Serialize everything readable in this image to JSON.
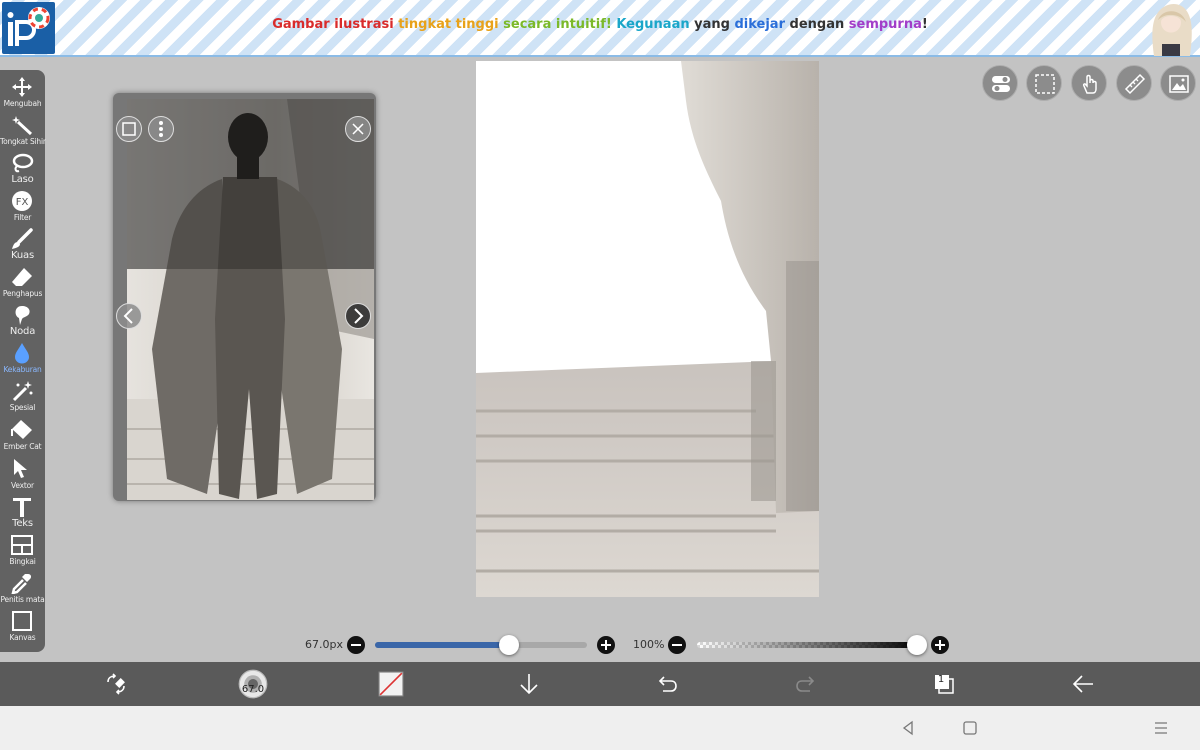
{
  "banner": {
    "segments": [
      {
        "text": "Gambar ilustrasi ",
        "color": "#d92b2b"
      },
      {
        "text": "tingkat tinggi ",
        "color": "#e8a21a"
      },
      {
        "text": "secara intuitif! ",
        "color": "#7bb929"
      },
      {
        "text": "Kegunaan ",
        "color": "#1aa6c9"
      },
      {
        "text": "yang ",
        "color": "#333333"
      },
      {
        "text": "dikejar ",
        "color": "#2b6fd9"
      },
      {
        "text": "dengan ",
        "color": "#333333"
      },
      {
        "text": "sempurna",
        "color": "#a23ec9"
      },
      {
        "text": "!",
        "color": "#333333"
      }
    ]
  },
  "toolbar": {
    "tools": [
      {
        "name": "move",
        "icon": "move-icon",
        "label": "Mengubah"
      },
      {
        "name": "magic-wand",
        "icon": "magic-wand-icon",
        "label": "Tongkat Sihir"
      },
      {
        "name": "lasso",
        "icon": "lasso-icon",
        "label": "Laso"
      },
      {
        "name": "filter",
        "icon": "fx-icon",
        "label": "Filter"
      },
      {
        "name": "brush",
        "icon": "brush-icon",
        "label": "Kuas"
      },
      {
        "name": "eraser",
        "icon": "eraser-icon",
        "label": "Penghapus"
      },
      {
        "name": "smudge",
        "icon": "smudge-icon",
        "label": "Noda"
      },
      {
        "name": "blur",
        "icon": "drop-icon",
        "label": "Kekaburan",
        "active": true
      },
      {
        "name": "special",
        "icon": "special-icon",
        "label": "Spesial"
      },
      {
        "name": "bucket",
        "icon": "bucket-icon",
        "label": "Ember Cat"
      },
      {
        "name": "vector",
        "icon": "cursor-icon",
        "label": "Vextor"
      },
      {
        "name": "text",
        "icon": "text-icon",
        "label": "Teks"
      },
      {
        "name": "frame",
        "icon": "frame-icon",
        "label": "Bingkai"
      },
      {
        "name": "eyedropper",
        "icon": "eyedropper-icon",
        "label": "Penitis mata"
      },
      {
        "name": "canvas",
        "icon": "canvas-icon",
        "label": "Kanvas"
      }
    ]
  },
  "brush": {
    "size_label": "67.0px",
    "size_fraction": 0.63,
    "opacity_label": "100%",
    "opacity_fraction": 1.0,
    "preview_value": "67.0"
  },
  "layers": {
    "count": "1"
  },
  "colors": {
    "accent": "#3a66a8",
    "active_tool": "#5aa0ff"
  }
}
